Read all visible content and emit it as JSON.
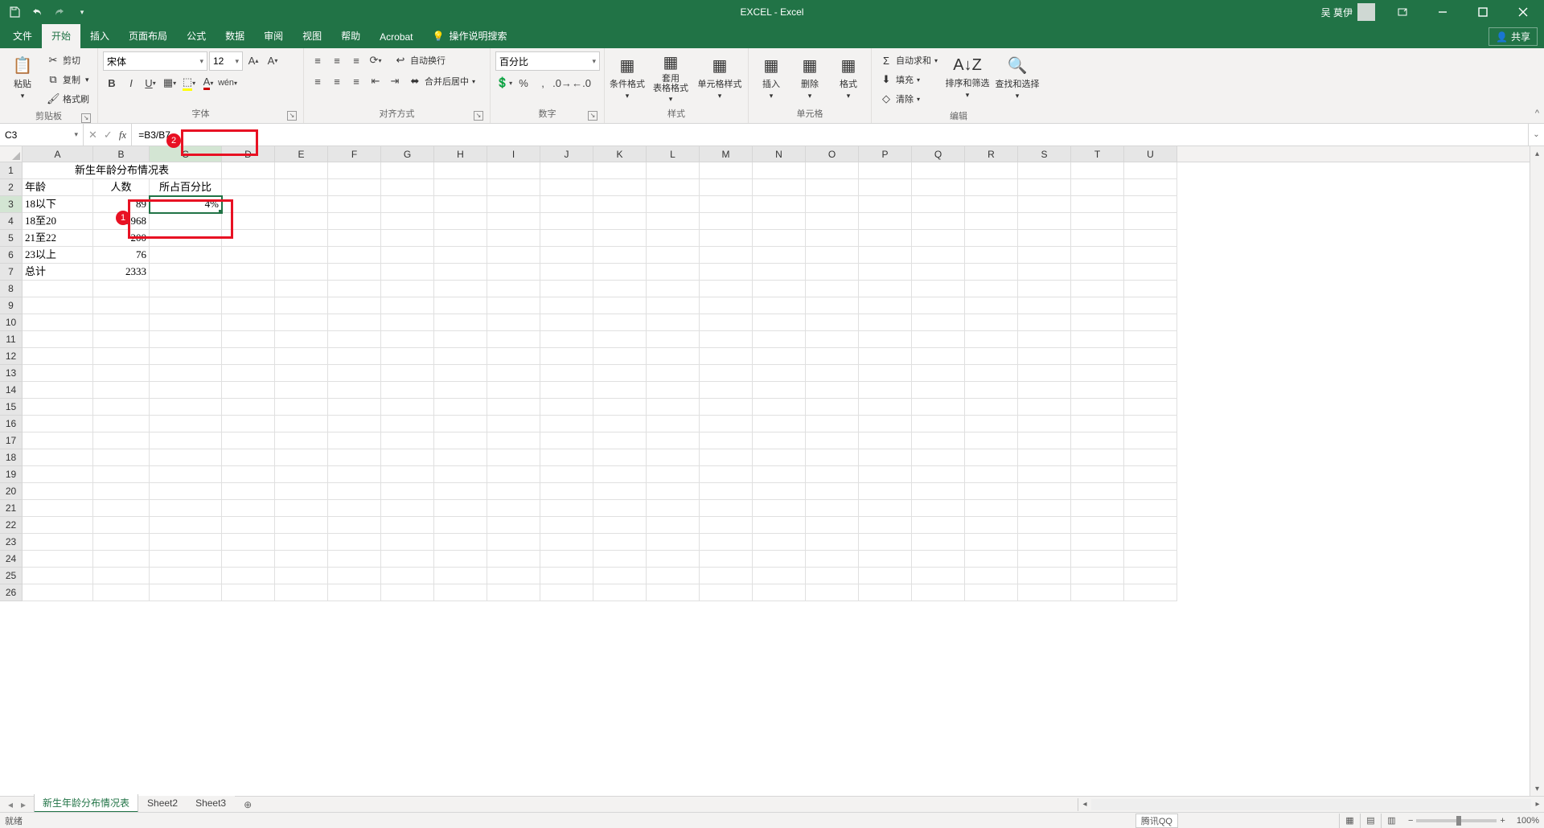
{
  "titlebar": {
    "title": "EXCEL  -  Excel",
    "user": "吴 莫伊"
  },
  "tabs": {
    "file": "文件",
    "home": "开始",
    "insert": "插入",
    "layout": "页面布局",
    "formulas": "公式",
    "data": "数据",
    "review": "审阅",
    "view": "视图",
    "help": "帮助",
    "acrobat": "Acrobat",
    "tellme": "操作说明搜索",
    "share": "共享"
  },
  "ribbon": {
    "clipboard": {
      "paste": "粘贴",
      "cut": "剪切",
      "copy": "复制",
      "format_painter": "格式刷",
      "label": "剪贴板"
    },
    "font": {
      "name": "宋体",
      "size": "12",
      "label": "字体"
    },
    "align": {
      "wrap": "自动换行",
      "merge": "合并后居中",
      "label": "对齐方式"
    },
    "number": {
      "format": "百分比",
      "label": "数字"
    },
    "styles": {
      "cond": "条件格式",
      "table": "套用\n表格格式",
      "cell": "单元格样式",
      "label": "样式"
    },
    "cells": {
      "insert": "插入",
      "delete": "删除",
      "format": "格式",
      "label": "单元格"
    },
    "editing": {
      "sum": "自动求和",
      "fill": "填充",
      "clear": "清除",
      "sort": "排序和筛选",
      "find": "查找和选择",
      "label": "编辑"
    }
  },
  "formula_bar": {
    "name_box": "C3",
    "formula": "=B3/B7"
  },
  "columns": [
    "A",
    "B",
    "C",
    "D",
    "E",
    "F",
    "G",
    "H",
    "I",
    "J",
    "K",
    "L",
    "M",
    "N",
    "O",
    "P",
    "Q",
    "R",
    "S",
    "T",
    "U"
  ],
  "sheet": {
    "title": "新生年龄分布情况表",
    "headers": {
      "age": "年龄",
      "count": "人数",
      "pct": "所占百分比"
    },
    "rows": [
      {
        "age": "18以下",
        "count": "89",
        "pct": "4%"
      },
      {
        "age": "18至20",
        "count": "1968",
        "pct": ""
      },
      {
        "age": "21至22",
        "count": "200",
        "pct": ""
      },
      {
        "age": "23以上",
        "count": "76",
        "pct": ""
      }
    ],
    "total": {
      "label": "总计",
      "count": "2333"
    }
  },
  "sheet_tabs": {
    "s1": "新生年龄分布情况表",
    "s2": "Sheet2",
    "s3": "Sheet3"
  },
  "status": {
    "ready": "就绪",
    "qq": "腾讯QQ",
    "zoom": "100%"
  },
  "annotations": {
    "badge1": "1",
    "badge2": "2"
  }
}
